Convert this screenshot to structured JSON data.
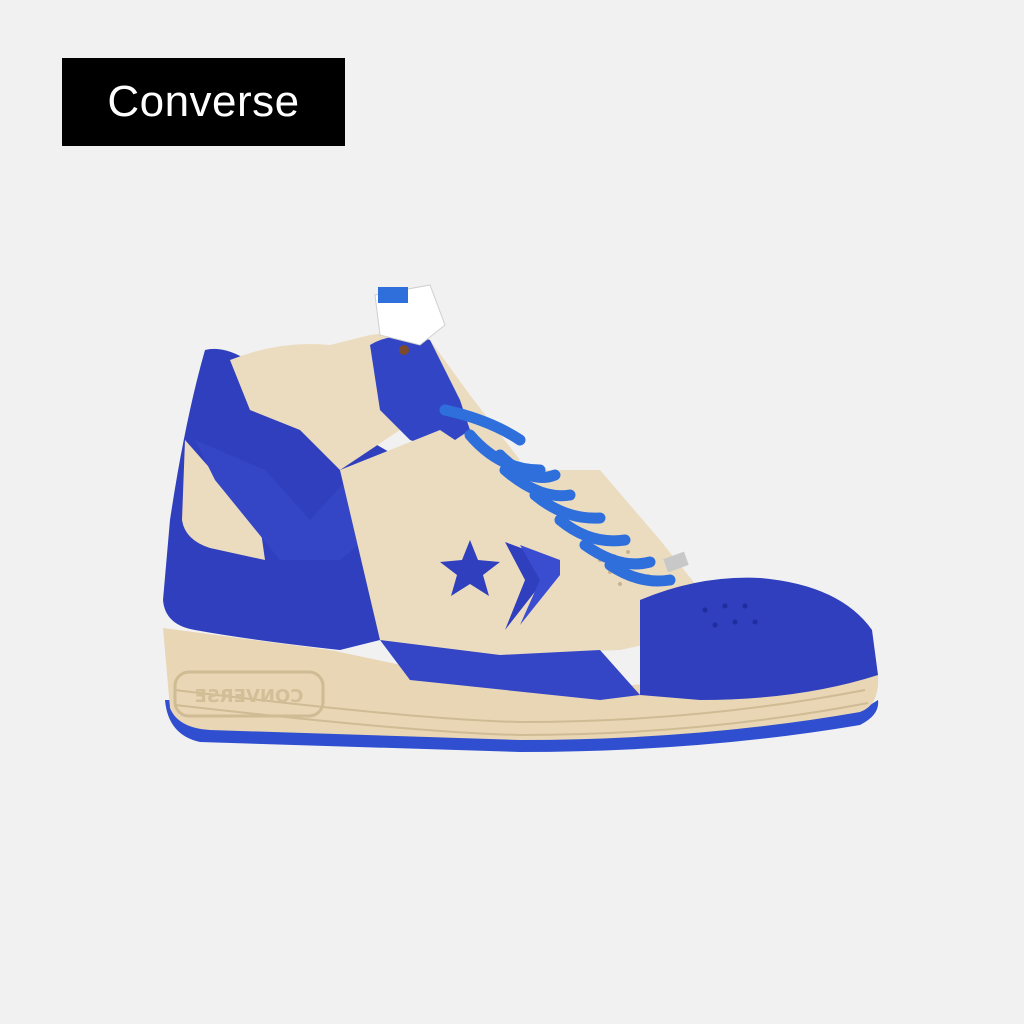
{
  "brand_label": "Converse",
  "sidewall_text": "CONVERSE",
  "colors": {
    "background": "#f1f1f1",
    "label_bg": "#000000",
    "label_text": "#ffffff",
    "royal_blue": "#2f3fbd",
    "royal_blue_dark": "#1f2d9e",
    "cream": "#ecdcbf",
    "cream_shadow": "#d9c6a3",
    "lace_blue": "#2f6fdc"
  },
  "icons": [
    "star-chevron-logo-icon",
    "shoe-lace-icon",
    "heel-tab-icon"
  ]
}
